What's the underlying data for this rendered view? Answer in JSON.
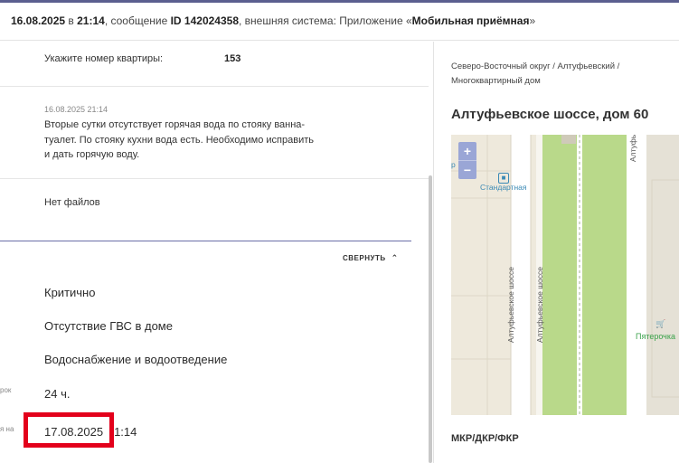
{
  "header": {
    "date": "16.08.2025",
    "at": " в ",
    "time": "21:14",
    "msg_prefix": ", сообщение ",
    "id": "ID 142024358",
    "system_prefix": ", внешняя система: Приложение «",
    "system_name": "Мобильная приёмная",
    "system_suffix": "»"
  },
  "details": {
    "apartment_label": "Укажите номер квартиры:",
    "apartment_value": "153",
    "comment_date": "16.08.2025 21:14",
    "comment_text": "Вторые сутки отсутствует горячая вода по стояку ванна-туалет. По стояку кухни вода есть. Необходимо исправить и дать горячую воду.",
    "files_text": "Нет файлов",
    "collapse_label": "СВЕРНУТЬ",
    "priority": "Критично",
    "problem": "Отсутствие ГВС в доме",
    "category": "Водоснабжение и водоотведение",
    "term": "24 ч.",
    "deadline_date": "17.08.2025",
    "deadline_time": "1:14",
    "cut_label_term": "рок",
    "cut_label_deadline": "я на"
  },
  "location": {
    "breadcrumb": "Северо-Восточный округ / Алтуфьевский / Многоквартирный дом",
    "address": "Алтуфьевское шоссе, дом 60",
    "map": {
      "zoom_in": "+",
      "zoom_out": "−",
      "bus_stop": "Стандартная",
      "road_1": "Алтуфьевское шоссе",
      "road_2": "Алтуфьевское шоссе",
      "road_3": "Алтуфь",
      "shop": "Пятерочка",
      "edge_letter": "р"
    },
    "district_type": "МКР/ДКР/ФКР"
  },
  "colors": {
    "accent": "#6b6fa8",
    "highlight": "#e3001b",
    "map_green": "#b9d98a"
  }
}
